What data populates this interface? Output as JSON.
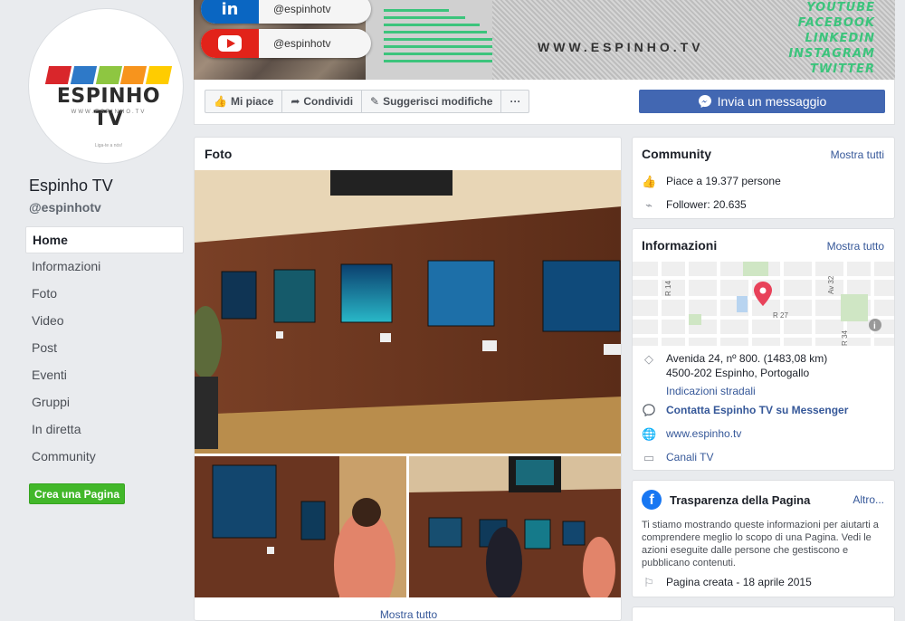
{
  "profile": {
    "logo_text": "ESPINHO TV",
    "logo_url": "WWW.ESPINHO.TV",
    "logo_tagline": "Liga-te a nós!",
    "logo_colors": [
      "#d9262b",
      "#2e79c8",
      "#8ec641",
      "#f7941d",
      "#ffcc00"
    ],
    "name": "Espinho TV",
    "handle": "@espinhotv"
  },
  "nav": {
    "items": [
      "Home",
      "Informazioni",
      "Foto",
      "Video",
      "Post",
      "Eventi",
      "Gruppi",
      "In diretta",
      "Community"
    ],
    "active_index": 0,
    "create_page_label": "Crea una Pagina"
  },
  "cover": {
    "pills": [
      {
        "icon": "linkedin-icon",
        "label": "@espinhotv",
        "color": "#0a66c2"
      },
      {
        "icon": "youtube-icon",
        "label": "@espinhotv",
        "color": "#e2231a"
      }
    ],
    "url_text": "WWW.ESPINHO.TV",
    "socials": [
      "YOUTUBE",
      "FACEBOOK",
      "LINKEDIN",
      "INSTAGRAM",
      "TWITTER"
    ],
    "accent": "#3cc47c"
  },
  "actions": {
    "like": "Mi piace",
    "share": "Condividi",
    "suggest": "Suggerisci modifiche",
    "more": "···",
    "message": "Invia un messaggio"
  },
  "photos": {
    "title": "Foto",
    "show_all": "Mostra tutto"
  },
  "community": {
    "title": "Community",
    "link": "Mostra tutti",
    "likes": "Piace a 19.377 persone",
    "followers": "Follower: 20.635"
  },
  "info": {
    "title": "Informazioni",
    "link": "Mostra tutto",
    "map_labels": [
      "R 14",
      "R 27",
      "Av 32",
      "R 34"
    ],
    "address_line1": "Avenida 24, nº 800. (1483,08 km)",
    "address_line2": "4500-202 Espinho, Portogallo",
    "directions": "Indicazioni stradali",
    "messenger": "Contatta Espinho TV su Messenger",
    "website": "www.espinho.tv",
    "category": "Canali TV"
  },
  "transparency": {
    "title": "Trasparenza della Pagina",
    "link": "Altro...",
    "text": "Ti stiamo mostrando queste informazioni per aiutarti a comprendere meglio lo scopo di una Pagina. Vedi le azioni eseguite dalle persone che gestiscono e pubblicano contenuti.",
    "created": "Pagina creata - 18 aprile 2015"
  },
  "colors": {
    "fb_blue": "#4267b2",
    "link": "#365899",
    "green": "#42b72a"
  }
}
